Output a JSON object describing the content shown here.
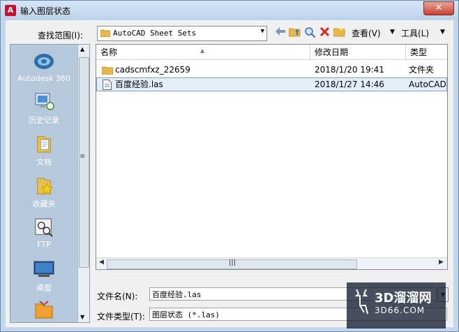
{
  "window": {
    "title": "输入图层状态",
    "close": "✕"
  },
  "toolbar": {
    "look_in_label": "查找范围(I):",
    "look_in_value": "AutoCAD Sheet Sets",
    "back_icon": "back-arrow-icon",
    "view_label": "查看(V)",
    "tools_label": "工具(L)"
  },
  "places": [
    {
      "label": "Autodesk 360",
      "icon": "cloud-icon"
    },
    {
      "label": "历史记录",
      "icon": "history-icon"
    },
    {
      "label": "文档",
      "icon": "documents-icon"
    },
    {
      "label": "收藏夹",
      "icon": "favorites-icon"
    },
    {
      "label": "FTP",
      "icon": "ftp-icon"
    },
    {
      "label": "桌面",
      "icon": "desktop-icon"
    }
  ],
  "file_list": {
    "columns": [
      "名称",
      "修改日期",
      "类型"
    ],
    "rows": [
      {
        "name": "cadscmfxz_22659",
        "date": "2018/1/20 19:41",
        "type": "文件夹",
        "icon": "folder-icon"
      },
      {
        "name": "百度经验.las",
        "date": "2018/1/27 14:46",
        "type": "AutoCAD",
        "icon": "las-file-icon"
      }
    ]
  },
  "bottom": {
    "filename_label": "文件名(N):",
    "filename_value": "百度经验.las",
    "filetype_label": "文件类型(T):",
    "filetype_value": "图层状态 (*.las)"
  },
  "watermark": {
    "big": "3D溜溜网",
    "small": "3D66.COM"
  }
}
